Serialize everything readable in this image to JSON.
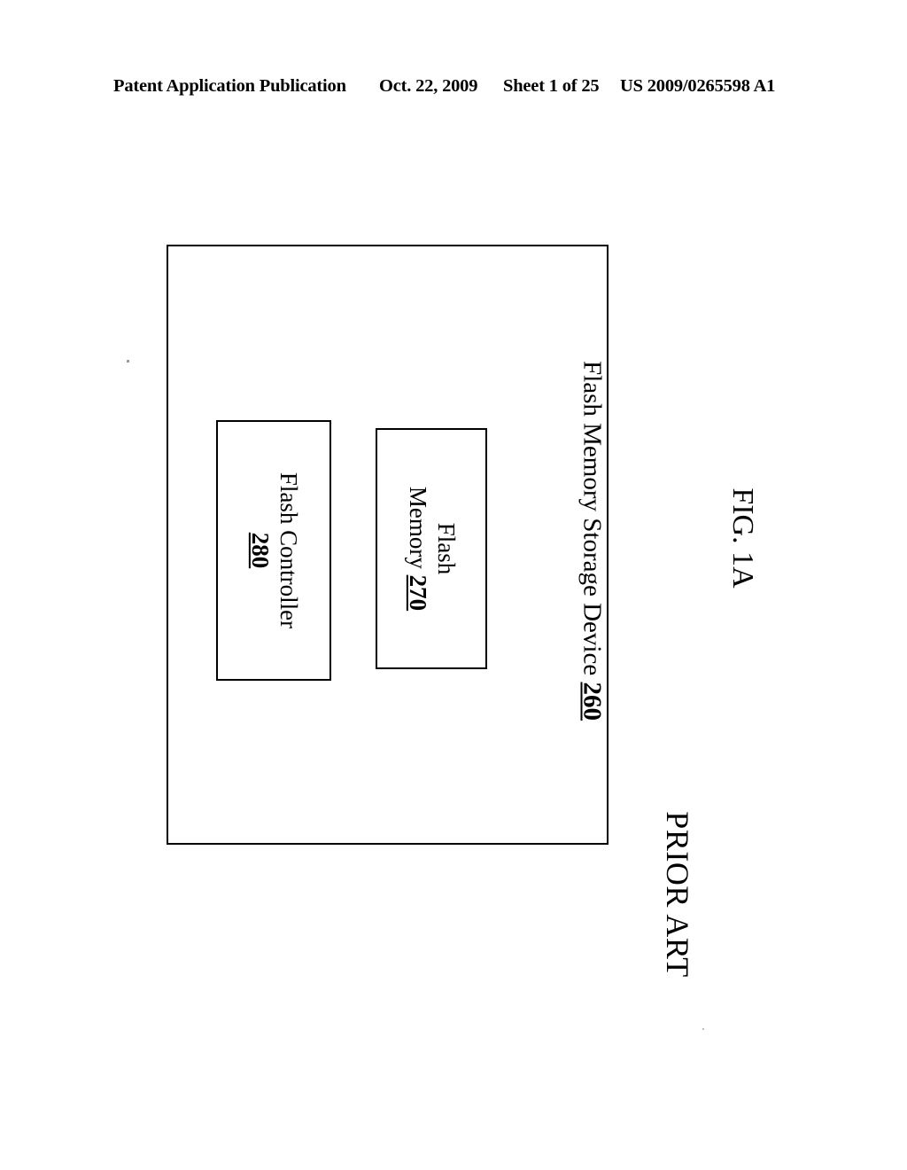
{
  "header": {
    "publication": "Patent Application Publication",
    "date": "Oct. 22, 2009",
    "sheet": "Sheet 1 of 25",
    "document_number": "US 2009/0265598 A1"
  },
  "figure": {
    "number": "FIG. 1A",
    "caption": "PRIOR ART",
    "device": {
      "label": "Flash Memory Storage Device",
      "reference_numeral": "260"
    },
    "blocks": [
      {
        "name": "flash-controller",
        "line1": "Flash Controller",
        "line2": "",
        "reference_numeral": "280"
      },
      {
        "name": "flash-memory",
        "line1": "Flash",
        "line2": "Memory",
        "reference_numeral": "270"
      }
    ]
  }
}
